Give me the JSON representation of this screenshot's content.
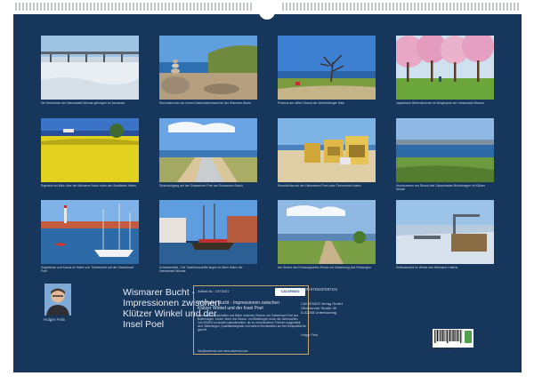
{
  "captions": [
    "Die Seebrücke der Hansestadt Wismar geborgen im Januareis.",
    "Steinmännchen an einem Küstensteinstrand bei der Wismarer Bucht",
    "Picknick am stillen Strand der Wohlenberger Wiek",
    "Japanische Blütenkirschen im Bürgerpark der Hansestadt Wismar",
    "Rapsfeld mit Blick über die Wismarer Bucht nahe des Stadtteiles Hafen",
    "Strandaufgang auf der Ostseeinsel Poel am Schwarzen Busch",
    "Strandkörbe auf der Ostseeinsel Poel nahe Timmendorf Hafen",
    "Hochsommer am Strand des Ostseebades Boltenhagen im Klützer Winkel",
    "Segelboote und Kanus im Hafen von Timmendorf auf der Ostseeinsel Poel",
    "Schwedenfest - Die Traditionsschiffe liegen im Alten Hafen der Hansestadt Wismar",
    "Am Strand des Erholungsortes Zierow mit Ostseeweg und Feldwegen",
    "Seitenansicht im Winter des Wismarer Hafens"
  ],
  "title": "Wismarer Bucht - Impressionen zwischen Klützer Winkel und der Insel Poel",
  "author": "Holger Felix",
  "info": {
    "article_no": "Artikel-Nr.: 1973431",
    "logo": "CALVENDO",
    "subtitle": "Wismarer Bucht - Impressionen zwischen Klützer Winkel und der Insel Poel",
    "body": "Imposante Landschaften und Bilder zwischen Wismar, der Ostseeinsel Poel und Boltenhagen. Sonne, Meer und Strand - ein Bilderbogen durch die Jahreszeiten. CALVENDO produziert kalenderseiten, die zu verschiedenen Themen ausgewählt sind. Bilderbogen, Qualitätsfotografie und weitere Monatsbilder auf ihre Bildqualität hin geprüft.",
    "url": "Info@calvendo.com www.calvendo.com"
  },
  "publisher": {
    "isbn": "ISBN 9783457597101",
    "address": [
      "CALVENDO Verlag GmbH",
      "Ottobrunner Straße 39",
      "D-82008 Unterhaching"
    ],
    "credit": "Holger Felix"
  },
  "barcode_digits": "9 783457 597101",
  "colors": {
    "panel": "#16365c",
    "frame": "#c9a56a"
  }
}
